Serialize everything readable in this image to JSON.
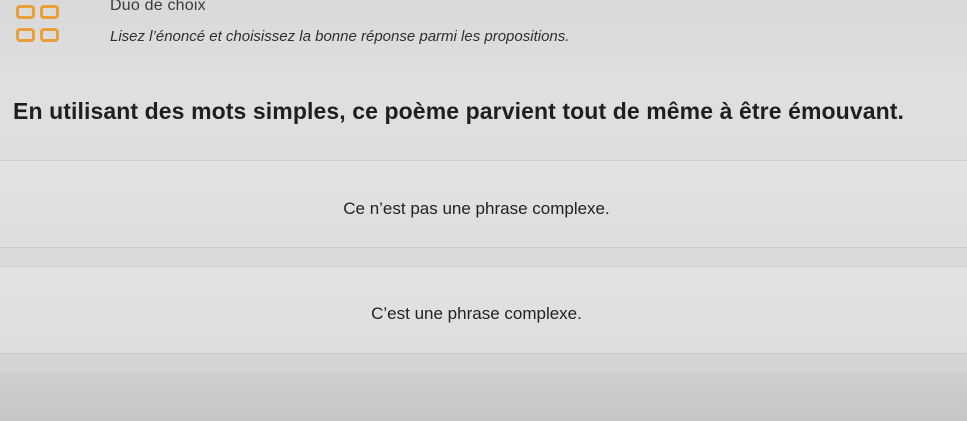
{
  "header": {
    "title": "Duo de choix",
    "instruction": "Lisez l’énoncé et choisissez la bonne réponse parmi les propositions.",
    "icon": "grid-2x2-icon",
    "accent_color": "#ea9f3a"
  },
  "question": {
    "text": "En utilisant des mots simples, ce poème parvient tout de même à être émouvant."
  },
  "options": [
    {
      "label": "Ce n’est pas une phrase complexe."
    },
    {
      "label": "C’est une phrase complexe."
    }
  ]
}
